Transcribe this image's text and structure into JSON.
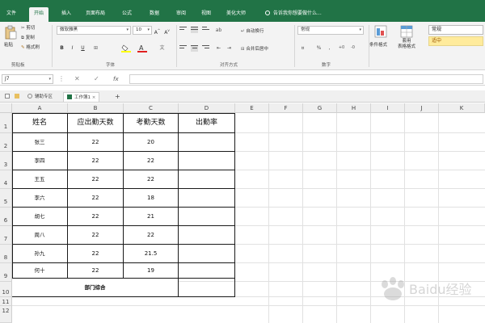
{
  "tabs": [
    "文件",
    "开始",
    "插入",
    "页面布局",
    "公式",
    "数据",
    "审阅",
    "视图",
    "美化大师"
  ],
  "active_tab": "开始",
  "tellme": "告诉我你想要做什么...",
  "ribbon": {
    "paste": "粘贴",
    "cut": "剪切",
    "copy": "复制",
    "format_painter": "格式刷",
    "clipboard_group": "剪贴板",
    "font_name": "微软雅黑",
    "font_size": "10",
    "font_group": "字体",
    "wrap_text": "自动换行",
    "merge_center": "合并后居中",
    "alignment_group": "对齐方式",
    "number_format": "常规",
    "number_group": "数字",
    "conditional_format": "条件格式",
    "format_as_table": "套用\n表格格式",
    "style_normal": "常规",
    "style_medium": "适中"
  },
  "formula_bar": {
    "name_box": "J7",
    "fx": "fx"
  },
  "workbook_tabs": [
    "辅助专区",
    "工作簿1"
  ],
  "columns": [
    "A",
    "B",
    "C",
    "D",
    "E",
    "F",
    "G",
    "H",
    "I",
    "J",
    "K"
  ],
  "rows": [
    "1",
    "2",
    "3",
    "4",
    "5",
    "6",
    "7",
    "8",
    "9",
    "10",
    "11",
    "12"
  ],
  "table": {
    "headers": [
      "姓名",
      "应出勤天数",
      "考勤天数",
      "出勤率"
    ],
    "rows": [
      [
        "张三",
        "22",
        "20",
        ""
      ],
      [
        "李四",
        "22",
        "22",
        ""
      ],
      [
        "王五",
        "22",
        "22",
        ""
      ],
      [
        "李六",
        "22",
        "18",
        ""
      ],
      [
        "胡七",
        "22",
        "21",
        ""
      ],
      [
        "周八",
        "22",
        "22",
        ""
      ],
      [
        "孙九",
        "22",
        "21.5",
        ""
      ],
      [
        "何十",
        "22",
        "19",
        ""
      ]
    ],
    "summary_label": "部门综合"
  },
  "watermark": "Baidu经验",
  "colors": {
    "accent": "#217346",
    "style_medium_bg": "#ffeb9c"
  }
}
